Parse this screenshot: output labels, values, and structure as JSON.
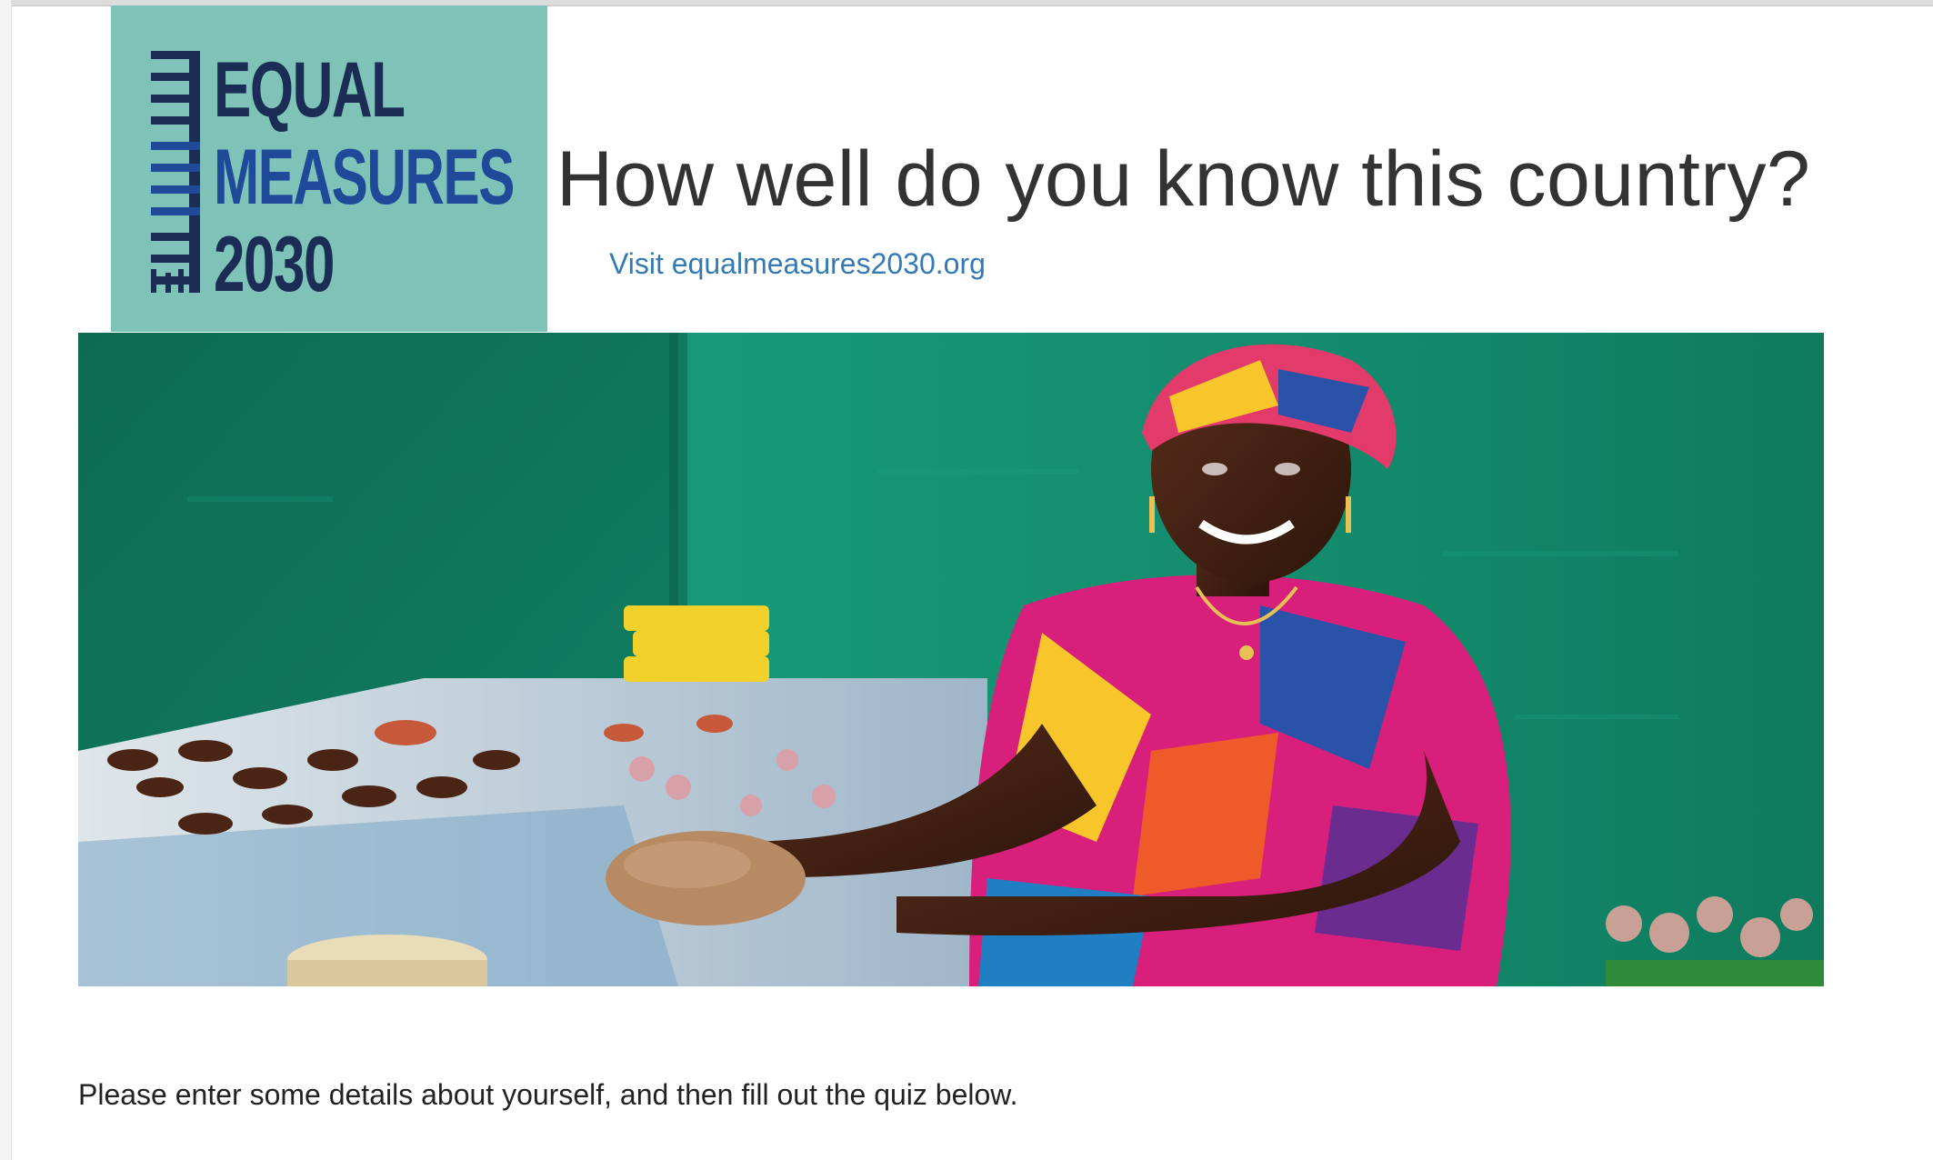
{
  "logo": {
    "line1": "EQUAL",
    "line2": "MEASURES",
    "line3": "2030",
    "background_color": "#7fc3b8",
    "text_color": "#1b2d55",
    "accent_color": "#1f4a9a"
  },
  "header": {
    "title": "How well do you know this country?",
    "link_text": "Visit equalmeasures2030.org"
  },
  "hero": {
    "icon": "photo-woman-market-stall"
  },
  "intro": {
    "text": "Please enter some details about yourself, and then fill out the quiz below."
  },
  "colors": {
    "title": "#333333",
    "link": "#337ab7",
    "body_text": "#222222"
  }
}
